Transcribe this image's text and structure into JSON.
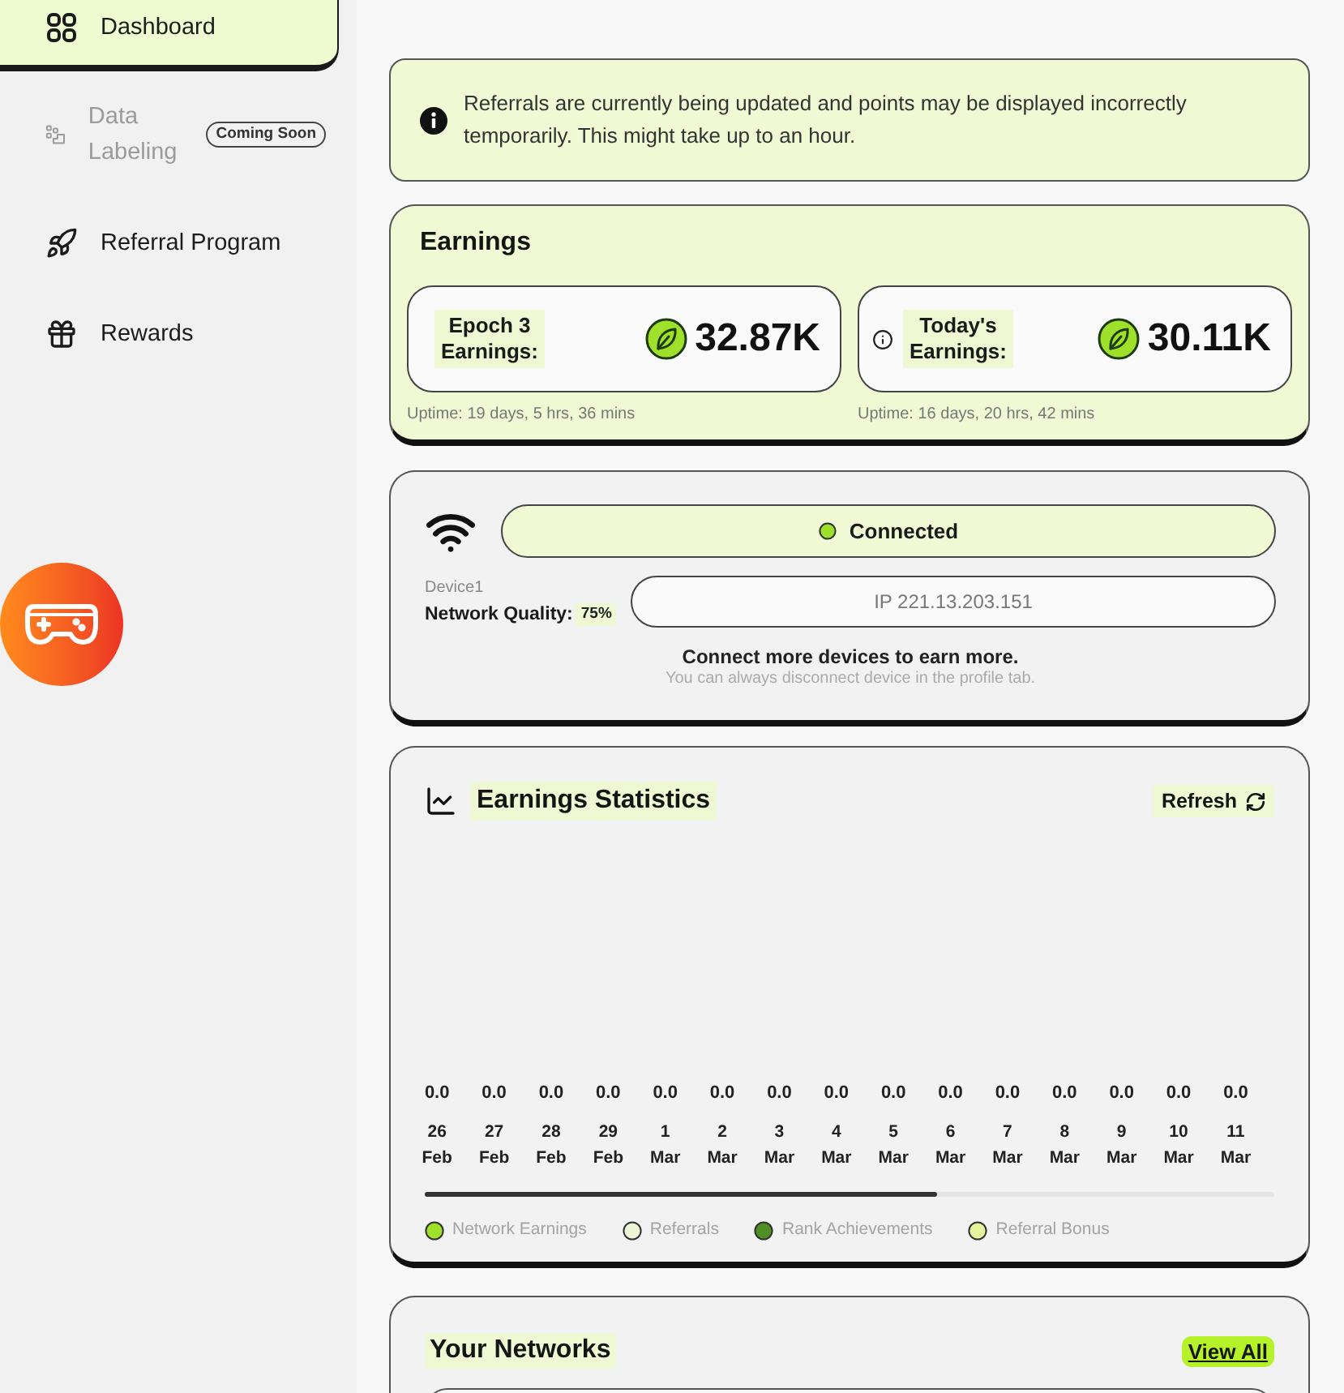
{
  "sidebar": {
    "items": [
      {
        "label": "Dashboard",
        "selected": true,
        "disabled": false
      },
      {
        "label": "Data Labeling",
        "selected": false,
        "disabled": true,
        "badge": "Coming Soon"
      },
      {
        "label": "Referral Program",
        "selected": false,
        "disabled": false
      },
      {
        "label": "Rewards",
        "selected": false,
        "disabled": false
      }
    ]
  },
  "notice": {
    "text": "Referrals are currently being updated and points may be displayed incorrectly temporarily. This might take up to an hour."
  },
  "earnings": {
    "title": "Earnings",
    "cards": [
      {
        "label": "Epoch 3 Earnings:",
        "value": "32.87K",
        "uptime": "Uptime: 19 days, 5 hrs, 36 mins",
        "info": false
      },
      {
        "label": "Today's Earnings:",
        "value": "30.11K",
        "uptime": "Uptime: 16 days, 20 hrs, 42 mins",
        "info": true
      }
    ]
  },
  "device": {
    "status": {
      "label": "Connected",
      "connected": true
    },
    "name": "Device1",
    "quality_label": "Network Quality:",
    "quality_value": "75%",
    "ip": "IP 221.13.203.151",
    "prompt": "Connect more devices to earn more.",
    "hint": "You can always disconnect device in the profile tab."
  },
  "statistics": {
    "title": "Earnings Statistics",
    "refresh": "Refresh",
    "days": [
      {
        "value": "0.0",
        "date": "26 Feb"
      },
      {
        "value": "0.0",
        "date": "27 Feb"
      },
      {
        "value": "0.0",
        "date": "28 Feb"
      },
      {
        "value": "0.0",
        "date": "29 Feb"
      },
      {
        "value": "0.0",
        "date": "1 Mar"
      },
      {
        "value": "0.0",
        "date": "2 Mar"
      },
      {
        "value": "0.0",
        "date": "3 Mar"
      },
      {
        "value": "0.0",
        "date": "4 Mar"
      },
      {
        "value": "0.0",
        "date": "5 Mar"
      },
      {
        "value": "0.0",
        "date": "6 Mar"
      },
      {
        "value": "0.0",
        "date": "7 Mar"
      },
      {
        "value": "0.0",
        "date": "8 Mar"
      },
      {
        "value": "0.0",
        "date": "9 Mar"
      },
      {
        "value": "0.0",
        "date": "10 Mar"
      },
      {
        "value": "0.0",
        "date": "11 Mar"
      }
    ],
    "legend": [
      {
        "label": "Network Earnings",
        "color": "#9fe02a"
      },
      {
        "label": "Referrals",
        "color": "#eef5d6"
      },
      {
        "label": "Rank Achievements",
        "color": "#4f8f23"
      },
      {
        "label": "Referral Bonus",
        "color": "#e6f49c"
      }
    ]
  },
  "networks": {
    "title": "Your Networks",
    "view_all": "View All"
  }
}
